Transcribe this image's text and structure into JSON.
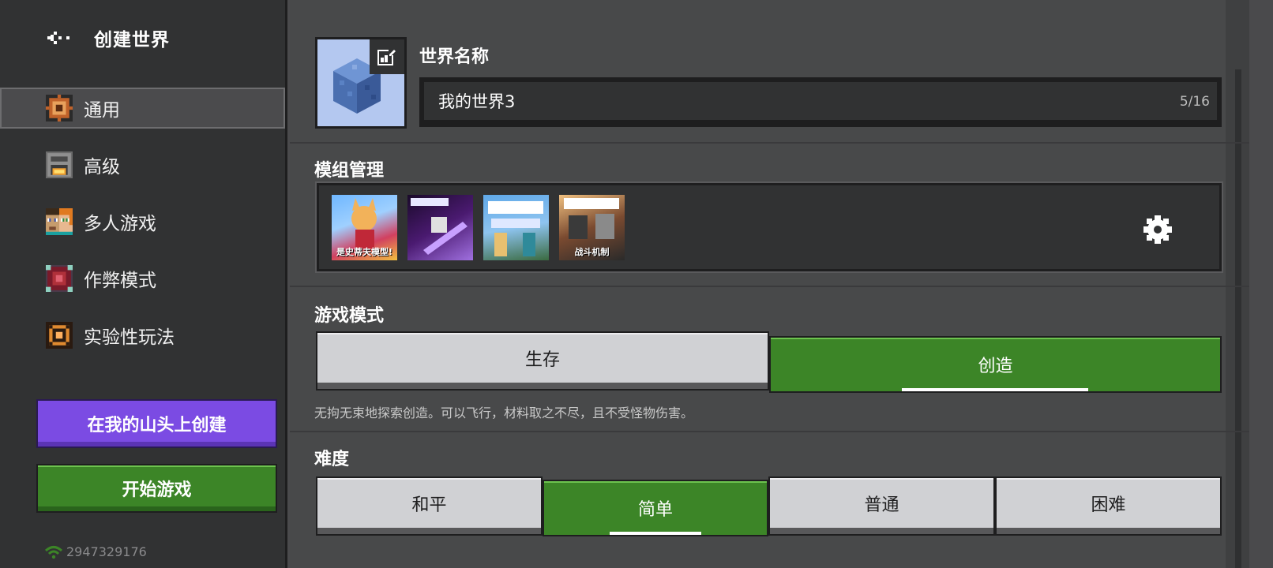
{
  "header": {
    "title": "创建世界"
  },
  "sidebar": {
    "items": [
      {
        "label": "通用",
        "icon": "general-settings-icon",
        "active": true
      },
      {
        "label": "高级",
        "icon": "furnace-icon",
        "active": false
      },
      {
        "label": "多人游戏",
        "icon": "steve-alex-icon",
        "active": false
      },
      {
        "label": "作弊模式",
        "icon": "command-block-icon",
        "active": false
      },
      {
        "label": "实验性玩法",
        "icon": "experimental-icon",
        "active": false
      }
    ],
    "realm_button": "在我的山头上创建",
    "play_button": "开始游戏",
    "user_id": "2947329176"
  },
  "world": {
    "name_label": "世界名称",
    "name_value": "我的世界3",
    "name_counter": "5/16"
  },
  "mods": {
    "title": "模组管理",
    "items": [
      {
        "name": "mod-yes-steve-model",
        "caption": "是史蒂夫模型!"
      },
      {
        "name": "mod-kid-action-ultrax",
        "caption": ""
      },
      {
        "name": "mod-action-next",
        "caption": ""
      },
      {
        "name": "mod-kid-action-ultra-combat",
        "caption": "战斗机制"
      }
    ]
  },
  "game_mode": {
    "title": "游戏模式",
    "options": [
      "生存",
      "创造"
    ],
    "selected": "创造",
    "description": "无拘无束地探索创造。可以飞行，材料取之不尽，且不受怪物伤害。"
  },
  "difficulty": {
    "title": "难度",
    "options": [
      "和平",
      "简单",
      "普通",
      "困难"
    ],
    "selected": "简单"
  },
  "colors": {
    "accent_green": "#3c8527",
    "realm_purple": "#7b4be3",
    "sidebar_bg": "#313233",
    "main_bg": "#48494a"
  }
}
